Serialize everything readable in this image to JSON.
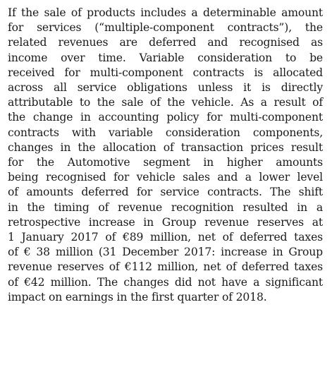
{
  "document": {
    "lines": [
      "If the sale of products includes a determinable amount",
      "for services (“multiple-component contracts”), the",
      "related revenues are deferred and recognised as",
      "income over time. Variable consideration to be",
      "received for multi-component contracts is allocated",
      "across all service obligations unless it is directly",
      "attributable to the sale of the vehicle. As a result of",
      "the change in accounting policy for multi-component",
      "contracts with variable consideration components,",
      "changes in the allocation of transaction prices result",
      "for the Automotive segment in higher amounts",
      "being recognised for vehicle sales and a lower level",
      "of amounts deferred for service contracts. The shift",
      "in the timing of revenue recognition resulted in a",
      "retrospective increase in Group revenue reserves at",
      "1 January 2017 of €89 million, net of deferred taxes",
      "of € 38 million (31 December 2017: increase in Group",
      "revenue reserves of €112 million, net of deferred taxes",
      "of €42 million. The changes did not have a significant",
      "impact on earnings in the first quarter of 2018."
    ]
  }
}
